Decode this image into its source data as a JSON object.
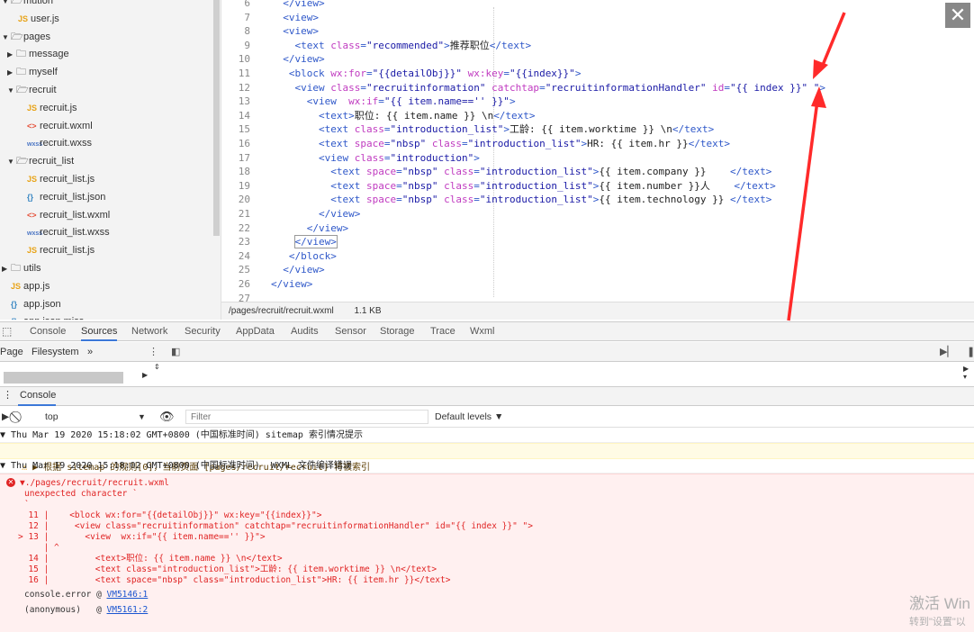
{
  "tree": {
    "items": [
      {
        "label": "mution",
        "kind": "folder",
        "indent": 0,
        "open": true
      },
      {
        "label": "user.js",
        "kind": "js",
        "indent": 2
      },
      {
        "label": "pages",
        "kind": "folder",
        "indent": 0,
        "open": true
      },
      {
        "label": "message",
        "kind": "folder",
        "indent": 1,
        "open": false
      },
      {
        "label": "myself",
        "kind": "folder",
        "indent": 1,
        "open": false
      },
      {
        "label": "recruit",
        "kind": "folder",
        "indent": 1,
        "open": true
      },
      {
        "label": "recruit.js",
        "kind": "js",
        "indent": 2
      },
      {
        "label": "recruit.wxml",
        "kind": "wxml",
        "indent": 2,
        "selected": true
      },
      {
        "label": "recruit.wxss",
        "kind": "wxss",
        "indent": 2
      },
      {
        "label": "recruit_list",
        "kind": "folder",
        "indent": 1,
        "open": true
      },
      {
        "label": "recruit_list.js",
        "kind": "js",
        "indent": 2
      },
      {
        "label": "recruit_list.json",
        "kind": "json",
        "indent": 2
      },
      {
        "label": "recruit_list.wxml",
        "kind": "wxml",
        "indent": 2
      },
      {
        "label": "recruit_list.wxss",
        "kind": "wxss",
        "indent": 2
      },
      {
        "label": "recruit_list.js",
        "kind": "js",
        "indent": 2
      },
      {
        "label": "utils",
        "kind": "folder",
        "indent": 0,
        "open": false
      },
      {
        "label": "app.js",
        "kind": "js",
        "indent": 0
      },
      {
        "label": "app.json",
        "kind": "json",
        "indent": 0
      },
      {
        "label": "app.json.miss",
        "kind": "json",
        "indent": 0
      }
    ]
  },
  "editor": {
    "lines": [
      {
        "n": "6",
        "indent": "  ",
        "code": [
          [
            "tg",
            "</view>"
          ]
        ]
      },
      {
        "n": "7",
        "indent": "  ",
        "code": [
          [
            "tg",
            "<view>"
          ]
        ]
      },
      {
        "n": "8",
        "indent": "  ",
        "code": [
          [
            "tg",
            "<view>"
          ]
        ]
      },
      {
        "n": "9",
        "indent": "    ",
        "code": [
          [
            "tg",
            "<text "
          ],
          [
            "at",
            "class"
          ],
          [
            "tg",
            "="
          ],
          [
            "st",
            "\"recommended\""
          ],
          [
            "tg",
            ">"
          ],
          [
            "tx",
            "推荐职位"
          ],
          [
            "tg",
            "</text>"
          ]
        ]
      },
      {
        "n": "10",
        "indent": "  ",
        "code": [
          [
            "tg",
            "</view>"
          ]
        ]
      },
      {
        "n": "11",
        "indent": "   ",
        "code": [
          [
            "tg",
            "<block "
          ],
          [
            "at",
            "wx:for"
          ],
          [
            "tg",
            "="
          ],
          [
            "st",
            "\"{{detailObj}}\""
          ],
          [
            "tx",
            " "
          ],
          [
            "at",
            "wx:key"
          ],
          [
            "tg",
            "="
          ],
          [
            "st",
            "\"{{index}}\""
          ],
          [
            "tg",
            ">"
          ]
        ]
      },
      {
        "n": "12",
        "indent": "    ",
        "code": [
          [
            "tg",
            "<view "
          ],
          [
            "at",
            "class"
          ],
          [
            "tg",
            "="
          ],
          [
            "st",
            "\"recruitinformation\""
          ],
          [
            "tx",
            " "
          ],
          [
            "at",
            "catchtap"
          ],
          [
            "tg",
            "="
          ],
          [
            "st",
            "\"recruitinformationHandler\""
          ],
          [
            "tx",
            " "
          ],
          [
            "at",
            "id"
          ],
          [
            "tg",
            "="
          ],
          [
            "st",
            "\"{{ index }}\""
          ],
          [
            "tx",
            " "
          ],
          [
            "st",
            "\""
          ],
          [
            "tg",
            ">"
          ]
        ]
      },
      {
        "n": "13",
        "indent": "      ",
        "code": [
          [
            "tg",
            "<view  "
          ],
          [
            "at",
            "wx:if"
          ],
          [
            "tg",
            "="
          ],
          [
            "st",
            "\"{{ item.name=='' }}\""
          ],
          [
            "tg",
            ">"
          ]
        ]
      },
      {
        "n": "14",
        "indent": "        ",
        "code": [
          [
            "tg",
            "<text>"
          ],
          [
            "tx",
            "职位: {{ item.name }} \\n"
          ],
          [
            "tg",
            "</text>"
          ]
        ]
      },
      {
        "n": "15",
        "indent": "        ",
        "code": [
          [
            "tg",
            "<text "
          ],
          [
            "at",
            "class"
          ],
          [
            "tg",
            "="
          ],
          [
            "st",
            "\"introduction_list\""
          ],
          [
            "tg",
            ">"
          ],
          [
            "tx",
            "工龄: {{ item.worktime }} \\n"
          ],
          [
            "tg",
            "</text>"
          ]
        ]
      },
      {
        "n": "16",
        "indent": "        ",
        "code": [
          [
            "tg",
            "<text "
          ],
          [
            "at",
            "space"
          ],
          [
            "tg",
            "="
          ],
          [
            "st",
            "\"nbsp\""
          ],
          [
            "tx",
            " "
          ],
          [
            "at",
            "class"
          ],
          [
            "tg",
            "="
          ],
          [
            "st",
            "\"introduction_list\""
          ],
          [
            "tg",
            ">"
          ],
          [
            "tx",
            "HR: {{ item.hr }}"
          ],
          [
            "tg",
            "</text>"
          ]
        ]
      },
      {
        "n": "17",
        "indent": "        ",
        "code": [
          [
            "tg",
            "<view "
          ],
          [
            "at",
            "class"
          ],
          [
            "tg",
            "="
          ],
          [
            "st",
            "\"introduction\""
          ],
          [
            "tg",
            ">"
          ]
        ]
      },
      {
        "n": "18",
        "indent": "          ",
        "code": [
          [
            "tg",
            "<text "
          ],
          [
            "at",
            "space"
          ],
          [
            "tg",
            "="
          ],
          [
            "st",
            "\"nbsp\""
          ],
          [
            "tx",
            " "
          ],
          [
            "at",
            "class"
          ],
          [
            "tg",
            "="
          ],
          [
            "st",
            "\"introduction_list\""
          ],
          [
            "tg",
            ">"
          ],
          [
            "tx",
            "{{ item.company }}    "
          ],
          [
            "tg",
            "</text>"
          ]
        ]
      },
      {
        "n": "19",
        "indent": "          ",
        "code": [
          [
            "tg",
            "<text "
          ],
          [
            "at",
            "space"
          ],
          [
            "tg",
            "="
          ],
          [
            "st",
            "\"nbsp\""
          ],
          [
            "tx",
            " "
          ],
          [
            "at",
            "class"
          ],
          [
            "tg",
            "="
          ],
          [
            "st",
            "\"introduction_list\""
          ],
          [
            "tg",
            ">"
          ],
          [
            "tx",
            "{{ item.number }}人    "
          ],
          [
            "tg",
            "</text>"
          ]
        ]
      },
      {
        "n": "20",
        "indent": "          ",
        "code": [
          [
            "tg",
            "<text "
          ],
          [
            "at",
            "space"
          ],
          [
            "tg",
            "="
          ],
          [
            "st",
            "\"nbsp\""
          ],
          [
            "tx",
            " "
          ],
          [
            "at",
            "class"
          ],
          [
            "tg",
            "="
          ],
          [
            "st",
            "\"introduction_list\""
          ],
          [
            "tg",
            ">"
          ],
          [
            "tx",
            "{{ item.technology }} "
          ],
          [
            "tg",
            "</text>"
          ]
        ]
      },
      {
        "n": "21",
        "indent": "        ",
        "code": [
          [
            "tg",
            "</view>"
          ]
        ]
      },
      {
        "n": "22",
        "indent": "      ",
        "code": [
          [
            "tg",
            "</view>"
          ]
        ]
      },
      {
        "n": "23",
        "indent": "    ",
        "code": [
          [
            "tg",
            "</view>"
          ]
        ]
      },
      {
        "n": "24",
        "indent": "   ",
        "code": [
          [
            "tg",
            "</block>"
          ]
        ]
      },
      {
        "n": "25",
        "indent": "  ",
        "code": [
          [
            "tg",
            "</view>"
          ]
        ]
      },
      {
        "n": "26",
        "indent": "",
        "code": [
          [
            "tg",
            "</view>"
          ]
        ]
      },
      {
        "n": "27",
        "indent": "",
        "code": []
      }
    ]
  },
  "status": {
    "path": "/pages/recruit/recruit.wxml",
    "size": "1.1 KB"
  },
  "close_label": "✕",
  "devtools": {
    "tabs": [
      "Console",
      "Sources",
      "Network",
      "Security",
      "AppData",
      "Audits",
      "Sensor",
      "Storage",
      "Trace",
      "Wxml"
    ],
    "active_tab": "Sources",
    "sources_subtabs": [
      "Page",
      "Filesystem",
      "»"
    ],
    "console_tab": "Console",
    "context": "top",
    "filter_placeholder": "Filter",
    "levels": "Default levels ▼"
  },
  "console": {
    "msg1": "▼ Thu Mar 19 2020 15:18:02 GMT+0800 (中国标准时间) sitemap 索引情况提示",
    "msg2": "▶ 根据 sitemap 的规则[0]，当前页面 [pages/recruit/recruit] 将被索引",
    "msg3": "▼ Thu Mar 19 2020 15:18:02 GMT+0800 (中国标准时间)  WXML 文件编译错误",
    "err_file": "▼./pages/recruit/recruit.wxml",
    "err_msg": "unexpected character `",
    "err_tick": "`",
    "snippet": [
      "  11 |    <block wx:for=\"{{detailObj}}\" wx:key=\"{{index}}\">",
      "  12 |     <view class=\"recruitinformation\" catchtap=\"recruitinformationHandler\" id=\"{{ index }}\" \">",
      "> 13 |       <view  wx:if=\"{{ item.name=='' }}\">",
      "     | ^",
      "  14 |         <text>职位: {{ item.name }} \\n</text>",
      "  15 |         <text class=\"introduction_list\">工龄: {{ item.worktime }} \\n</text>",
      "  16 |         <text space=\"nbsp\" class=\"introduction_list\">HR: {{ item.hr }}</text>"
    ],
    "trace1_label": "console.error @ ",
    "trace1_link": "VM5146:1",
    "trace2_label": "(anonymous)   @ ",
    "trace2_link": "VM5161:2"
  },
  "watermark": {
    "line1": "激活 Win",
    "line2": "转到\"设置\"以"
  }
}
